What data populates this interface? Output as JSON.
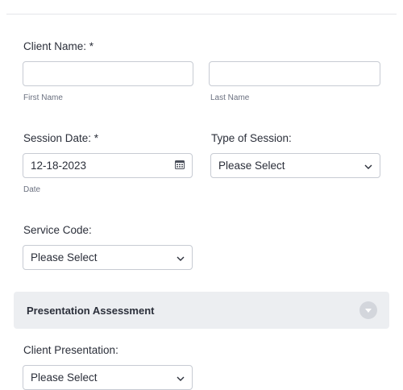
{
  "client_name": {
    "label": "Client Name: *",
    "first_value": "",
    "first_sublabel": "First Name",
    "last_value": "",
    "last_sublabel": "Last Name"
  },
  "session_date": {
    "label": "Session Date: *",
    "value": "12-18-2023",
    "sublabel": "Date",
    "icon": "calendar-icon"
  },
  "type_of_session": {
    "label": "Type of Session:",
    "value": "Please Select"
  },
  "service_code": {
    "label": "Service Code:",
    "value": "Please Select"
  },
  "section": {
    "title": "Presentation Assessment",
    "toggle_icon": "chevron-down-circle-icon"
  },
  "client_presentation": {
    "label": "Client Presentation:",
    "value": "Please Select"
  }
}
